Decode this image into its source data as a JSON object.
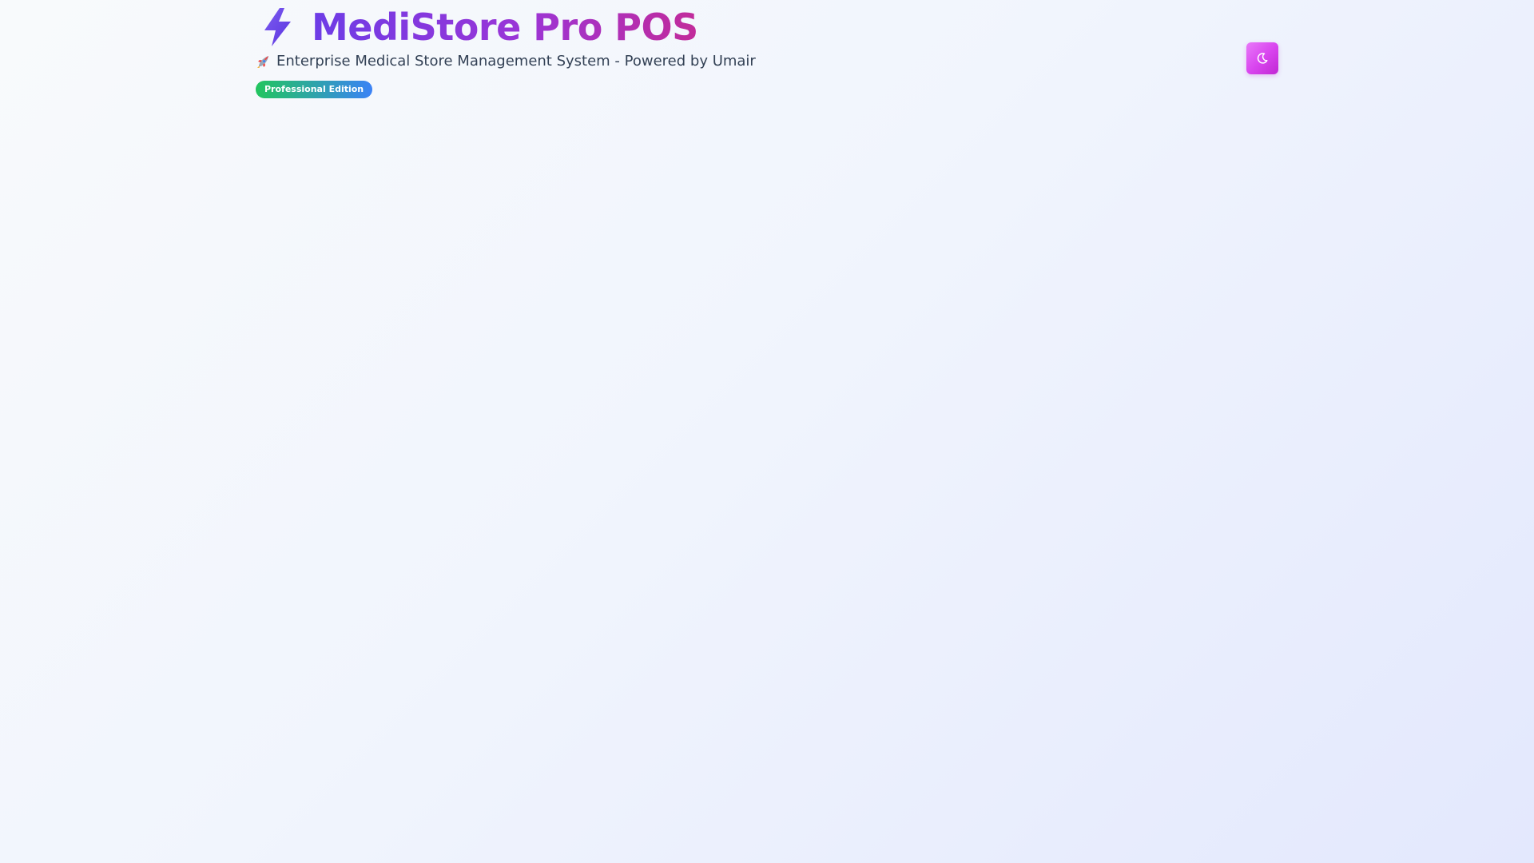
{
  "app": {
    "title": "MediStore Pro POS",
    "subtitle": "Enterprise Medical Store Management System - Powered by Umair",
    "edition_badge": "Professional Edition"
  },
  "icons": {
    "logo": "lightning-bolt-icon",
    "subtitle_prefix": "rocket-icon",
    "theme_toggle": "moon-icon"
  },
  "colors": {
    "title_gradient_start": "#6d3ce6",
    "title_gradient_end": "#c22b9a",
    "badge_gradient_start": "#22c55e",
    "badge_gradient_end": "#3b82f6",
    "toggle_gradient_start": "#e879f9",
    "toggle_gradient_end": "#c026d3",
    "subtitle_text": "#334155"
  }
}
